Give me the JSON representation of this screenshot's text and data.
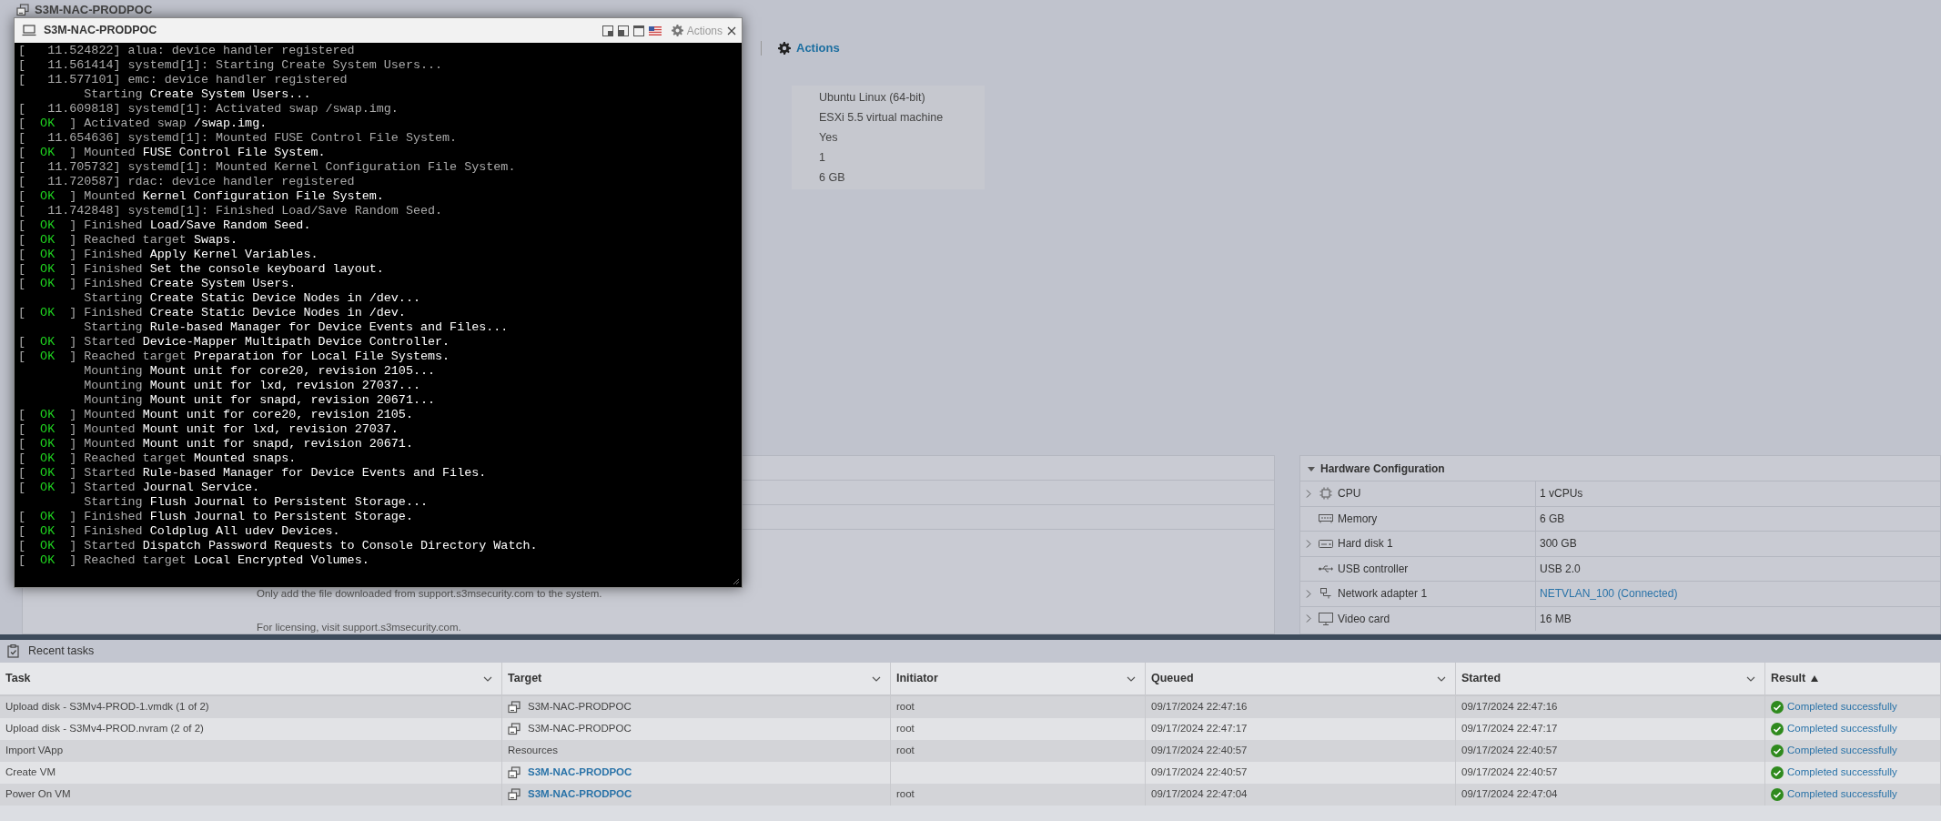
{
  "page": {
    "title": "S3M-NAC-PRODPOC",
    "actions": "Actions"
  },
  "summary_values": [
    "Ubuntu Linux (64-bit)",
    "ESXi 5.5 virtual machine",
    "Yes",
    "1",
    "6 GB"
  ],
  "notes_panel": {
    "lines": [
      "Only add the file downloaded from support.s3msecurity.com to the system.",
      "For licensing, visit support.s3msecurity.com."
    ]
  },
  "console": {
    "title": "S3M-NAC-PRODPOC",
    "actions": "Actions",
    "lines": [
      {
        "kind": "kernel",
        "text": "[   11.524822] alua: device handler registered"
      },
      {
        "kind": "kernel",
        "text": "[   11.561414] systemd[1]: Starting Create System Users..."
      },
      {
        "kind": "kernel",
        "text": "[   11.577101] emc: device handler registered"
      },
      {
        "kind": "job",
        "verb": "Starting",
        "object": "Create System Users..."
      },
      {
        "kind": "kernel",
        "text": "[   11.609818] systemd[1]: Activated swap /swap.img."
      },
      {
        "kind": "ok",
        "open": "[",
        "status": "OK",
        "close": "]",
        "verb": "Activated swap",
        "object": "/swap.img."
      },
      {
        "kind": "kernel",
        "text": "[   11.654636] systemd[1]: Mounted FUSE Control File System."
      },
      {
        "kind": "ok",
        "open": "[",
        "status": "OK",
        "close": "]",
        "verb": "Mounted",
        "object": "FUSE Control File System."
      },
      {
        "kind": "kernel",
        "text": "[   11.705732] systemd[1]: Mounted Kernel Configuration File System."
      },
      {
        "kind": "kernel",
        "text": "[   11.720587] rdac: device handler registered"
      },
      {
        "kind": "ok",
        "open": "[",
        "status": "OK",
        "close": "]",
        "verb": "Mounted",
        "object": "Kernel Configuration File System."
      },
      {
        "kind": "kernel",
        "text": "[   11.742848] systemd[1]: Finished Load/Save Random Seed."
      },
      {
        "kind": "ok",
        "open": "[",
        "status": "OK",
        "close": "]",
        "verb": "Finished",
        "object": "Load/Save Random Seed."
      },
      {
        "kind": "ok",
        "open": "[",
        "status": "OK",
        "close": "]",
        "verb": "Reached target",
        "object": "Swaps."
      },
      {
        "kind": "ok",
        "open": "[",
        "status": "OK",
        "close": "]",
        "verb": "Finished",
        "object": "Apply Kernel Variables."
      },
      {
        "kind": "ok",
        "open": "[",
        "status": "OK",
        "close": "]",
        "verb": "Finished",
        "object": "Set the console keyboard layout."
      },
      {
        "kind": "ok",
        "open": "[",
        "status": "OK",
        "close": "]",
        "verb": "Finished",
        "object": "Create System Users."
      },
      {
        "kind": "job",
        "verb": "Starting",
        "object": "Create Static Device Nodes in /dev..."
      },
      {
        "kind": "ok",
        "open": "[",
        "status": "OK",
        "close": "]",
        "verb": "Finished",
        "object": "Create Static Device Nodes in /dev."
      },
      {
        "kind": "job",
        "verb": "Starting",
        "object": "Rule-based Manager for Device Events and Files..."
      },
      {
        "kind": "ok",
        "open": "[",
        "status": "OK",
        "close": "]",
        "verb": "Started",
        "object": "Device-Mapper Multipath Device Controller."
      },
      {
        "kind": "ok",
        "open": "[",
        "status": "OK",
        "close": "]",
        "verb": "Reached target",
        "object": "Preparation for Local File Systems."
      },
      {
        "kind": "job",
        "verb": "Mounting",
        "object": "Mount unit for core20, revision 2105..."
      },
      {
        "kind": "job",
        "verb": "Mounting",
        "object": "Mount unit for lxd, revision 27037..."
      },
      {
        "kind": "job",
        "verb": "Mounting",
        "object": "Mount unit for snapd, revision 20671..."
      },
      {
        "kind": "ok",
        "open": "[",
        "status": "OK",
        "close": "]",
        "verb": "Mounted",
        "object": "Mount unit for core20, revision 2105."
      },
      {
        "kind": "ok",
        "open": "[",
        "status": "OK",
        "close": "]",
        "verb": "Mounted",
        "object": "Mount unit for lxd, revision 27037."
      },
      {
        "kind": "ok",
        "open": "[",
        "status": "OK",
        "close": "]",
        "verb": "Mounted",
        "object": "Mount unit for snapd, revision 20671."
      },
      {
        "kind": "ok",
        "open": "[",
        "status": "OK",
        "close": "]",
        "verb": "Reached target",
        "object": "Mounted snaps."
      },
      {
        "kind": "ok",
        "open": "[",
        "status": "OK",
        "close": "]",
        "verb": "Started",
        "object": "Rule-based Manager for Device Events and Files."
      },
      {
        "kind": "ok",
        "open": "[",
        "status": "OK",
        "close": "]",
        "verb": "Started",
        "object": "Journal Service."
      },
      {
        "kind": "job",
        "verb": "Starting",
        "object": "Flush Journal to Persistent Storage..."
      },
      {
        "kind": "ok",
        "open": "[",
        "status": "OK",
        "close": "]",
        "verb": "Finished",
        "object": "Flush Journal to Persistent Storage."
      },
      {
        "kind": "ok",
        "open": "[",
        "status": "OK",
        "close": "]",
        "verb": "Finished",
        "object": "Coldplug All udev Devices."
      },
      {
        "kind": "ok",
        "open": "[",
        "status": "OK",
        "close": "]",
        "verb": "Started",
        "object": "Dispatch Password Requests to Console Directory Watch."
      },
      {
        "kind": "ok",
        "open": "[",
        "status": "OK",
        "close": "]",
        "verb": "Reached target",
        "object": "Local Encrypted Volumes."
      }
    ]
  },
  "hardware": {
    "title": "Hardware Configuration",
    "expanded": true,
    "rows": [
      {
        "label": "CPU",
        "value": "1 vCPUs",
        "expandable": true,
        "kind": "text"
      },
      {
        "label": "Memory",
        "value": "6 GB",
        "expandable": false,
        "kind": "text"
      },
      {
        "label": "Hard disk 1",
        "value": "300 GB",
        "expandable": true,
        "kind": "text"
      },
      {
        "label": "USB controller",
        "value": "USB 2.0",
        "expandable": false,
        "kind": "text"
      },
      {
        "label": "Network adapter 1",
        "value": "NETVLAN_100 (Connected)",
        "expandable": true,
        "kind": "link"
      },
      {
        "label": "Video card",
        "value": "16 MB",
        "expandable": true,
        "kind": "text"
      }
    ]
  },
  "recent_tasks": {
    "title": "Recent tasks",
    "columns": [
      {
        "label": "Task",
        "sorted_ascending": false
      },
      {
        "label": "Target",
        "sorted_ascending": false
      },
      {
        "label": "Initiator",
        "sorted_ascending": false
      },
      {
        "label": "Queued",
        "sorted_ascending": false
      },
      {
        "label": "Started",
        "sorted_ascending": false
      },
      {
        "label": "Result",
        "sorted_ascending": true
      }
    ],
    "rows": [
      {
        "task": "Upload disk - S3Mv4-PROD-1.vmdk (1 of 2)",
        "target": {
          "text": "S3M-NAC-PRODPOC",
          "has_icon": true,
          "link": false
        },
        "initiator": "root",
        "queued": "09/17/2024 22:47:16",
        "started": "09/17/2024 22:47:16",
        "result": {
          "text": "Completed successfully",
          "succeeded": true
        }
      },
      {
        "task": "Upload disk - S3Mv4-PROD.nvram (2 of 2)",
        "target": {
          "text": "S3M-NAC-PRODPOC",
          "has_icon": true,
          "link": false
        },
        "initiator": "root",
        "queued": "09/17/2024 22:47:17",
        "started": "09/17/2024 22:47:17",
        "result": {
          "text": "Completed successfully",
          "succeeded": true
        }
      },
      {
        "task": "Import VApp",
        "target": {
          "text": "Resources",
          "has_icon": false,
          "link": false
        },
        "initiator": "root",
        "queued": "09/17/2024 22:40:57",
        "started": "09/17/2024 22:40:57",
        "result": {
          "text": "Completed successfully",
          "succeeded": true
        }
      },
      {
        "task": "Create VM",
        "target": {
          "text": "S3M-NAC-PRODPOC",
          "has_icon": true,
          "link": true
        },
        "queued": "09/17/2024 22:40:57",
        "started": "09/17/2024 22:40:57",
        "result": {
          "text": "Completed successfully",
          "succeeded": true
        }
      },
      {
        "task": "Power On VM",
        "target": {
          "text": "S3M-NAC-PRODPOC",
          "has_icon": true,
          "link": true
        },
        "initiator": "root",
        "queued": "09/17/2024 22:47:04",
        "started": "09/17/2024 22:47:04",
        "result": {
          "text": "Completed successfully",
          "succeeded": true
        }
      }
    ]
  }
}
